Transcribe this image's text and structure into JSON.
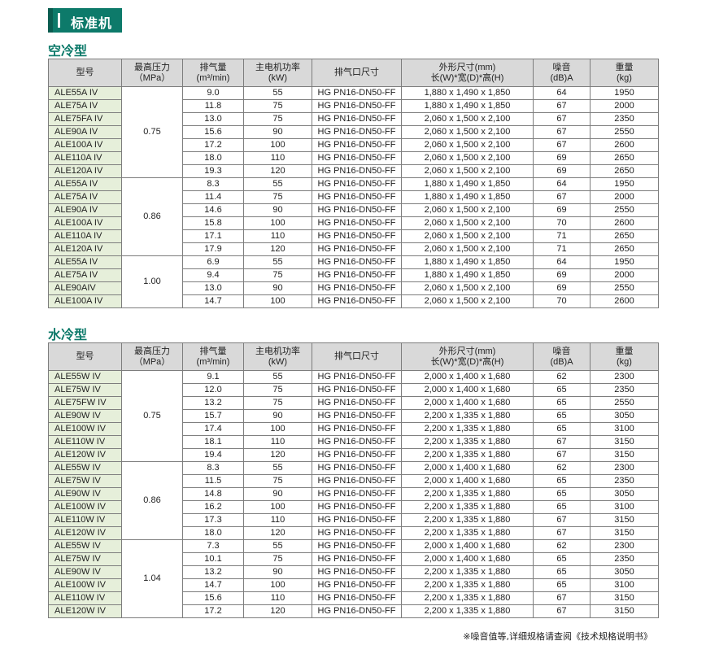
{
  "banner": {
    "title": "标准机"
  },
  "headers": {
    "model": "型号",
    "pressure": [
      "最高压力",
      "（MPa）"
    ],
    "flow": [
      "排气量",
      "(m³/min)"
    ],
    "power": [
      "主电机功率",
      "(kW)"
    ],
    "outlet": "排气口尺寸",
    "dims": [
      "外形尺寸(mm)",
      "长(W)*宽(D)*高(H)"
    ],
    "noise": [
      "噪音",
      "(dB)A"
    ],
    "weight": [
      "重量",
      "(kg)"
    ]
  },
  "sections": [
    {
      "title": "空冷型",
      "groups": [
        {
          "pressure": "0.75",
          "rows": [
            [
              "ALE55A IV",
              "9.0",
              "55",
              "HG PN16-DN50-FF",
              "1,880 x 1,490 x 1,850",
              "64",
              "1950"
            ],
            [
              "ALE75A IV",
              "11.8",
              "75",
              "HG PN16-DN50-FF",
              "1,880 x 1,490 x 1,850",
              "67",
              "2000"
            ],
            [
              "ALE75FA IV",
              "13.0",
              "75",
              "HG PN16-DN50-FF",
              "2,060 x 1,500 x 2,100",
              "67",
              "2350"
            ],
            [
              "ALE90A IV",
              "15.6",
              "90",
              "HG PN16-DN50-FF",
              "2,060 x 1,500 x 2,100",
              "67",
              "2550"
            ],
            [
              "ALE100A IV",
              "17.2",
              "100",
              "HG PN16-DN50-FF",
              "2,060 x 1,500 x 2,100",
              "67",
              "2600"
            ],
            [
              "ALE110A IV",
              "18.0",
              "110",
              "HG PN16-DN50-FF",
              "2,060 x 1,500 x 2,100",
              "69",
              "2650"
            ],
            [
              "ALE120A IV",
              "19.3",
              "120",
              "HG PN16-DN50-FF",
              "2,060 x 1,500 x 2,100",
              "69",
              "2650"
            ]
          ]
        },
        {
          "pressure": "0.86",
          "rows": [
            [
              "ALE55A IV",
              "8.3",
              "55",
              "HG PN16-DN50-FF",
              "1,880 x 1,490 x 1,850",
              "64",
              "1950"
            ],
            [
              "ALE75A IV",
              "11.4",
              "75",
              "HG PN16-DN50-FF",
              "1,880 x 1,490 x 1,850",
              "67",
              "2000"
            ],
            [
              "ALE90A IV",
              "14.6",
              "90",
              "HG PN16-DN50-FF",
              "2,060 x 1,500 x 2,100",
              "69",
              "2550"
            ],
            [
              "ALE100A IV",
              "15.8",
              "100",
              "HG PN16-DN50-FF",
              "2,060 x 1,500 x 2,100",
              "70",
              "2600"
            ],
            [
              "ALE110A IV",
              "17.1",
              "110",
              "HG PN16-DN50-FF",
              "2,060 x 1,500 x 2,100",
              "71",
              "2650"
            ],
            [
              "ALE120A IV",
              "17.9",
              "120",
              "HG PN16-DN50-FF",
              "2,060 x 1,500 x 2,100",
              "71",
              "2650"
            ]
          ]
        },
        {
          "pressure": "1.00",
          "rows": [
            [
              "ALE55A IV",
              "6.9",
              "55",
              "HG PN16-DN50-FF",
              "1,880 x 1,490 x 1,850",
              "64",
              "1950"
            ],
            [
              "ALE75A IV",
              "9.4",
              "75",
              "HG PN16-DN50-FF",
              "1,880 x 1,490 x 1,850",
              "69",
              "2000"
            ],
            [
              "ALE90AIV",
              "13.0",
              "90",
              "HG PN16-DN50-FF",
              "2,060 x 1,500 x 2,100",
              "69",
              "2550"
            ],
            [
              "ALE100A IV",
              "14.7",
              "100",
              "HG PN16-DN50-FF",
              "2,060 x 1,500 x 2,100",
              "70",
              "2600"
            ]
          ]
        }
      ]
    },
    {
      "title": "水冷型",
      "groups": [
        {
          "pressure": "0.75",
          "rows": [
            [
              "ALE55W IV",
              "9.1",
              "55",
              "HG PN16-DN50-FF",
              "2,000 x 1,400 x 1,680",
              "62",
              "2300"
            ],
            [
              "ALE75W IV",
              "12.0",
              "75",
              "HG PN16-DN50-FF",
              "2,000 x 1,400 x 1,680",
              "65",
              "2350"
            ],
            [
              "ALE75FW IV",
              "13.2",
              "75",
              "HG PN16-DN50-FF",
              "2,000 x 1,400 x 1,680",
              "65",
              "2550"
            ],
            [
              "ALE90W IV",
              "15.7",
              "90",
              "HG PN16-DN50-FF",
              "2,200 x 1,335 x 1,880",
              "65",
              "3050"
            ],
            [
              "ALE100W IV",
              "17.4",
              "100",
              "HG PN16-DN50-FF",
              "2,200 x 1,335 x 1,880",
              "65",
              "3100"
            ],
            [
              "ALE110W IV",
              "18.1",
              "110",
              "HG PN16-DN50-FF",
              "2,200 x 1,335 x 1,880",
              "67",
              "3150"
            ],
            [
              "ALE120W IV",
              "19.4",
              "120",
              "HG PN16-DN50-FF",
              "2,200 x 1,335 x 1,880",
              "67",
              "3150"
            ]
          ]
        },
        {
          "pressure": "0.86",
          "rows": [
            [
              "ALE55W IV",
              "8.3",
              "55",
              "HG PN16-DN50-FF",
              "2,000 x 1,400 x 1,680",
              "62",
              "2300"
            ],
            [
              "ALE75W IV",
              "11.5",
              "75",
              "HG PN16-DN50-FF",
              "2,000 x 1,400 x 1,680",
              "65",
              "2350"
            ],
            [
              "ALE90W IV",
              "14.8",
              "90",
              "HG PN16-DN50-FF",
              "2,200 x 1,335 x 1,880",
              "65",
              "3050"
            ],
            [
              "ALE100W IV",
              "16.2",
              "100",
              "HG PN16-DN50-FF",
              "2,200 x 1,335 x 1,880",
              "65",
              "3100"
            ],
            [
              "ALE110W IV",
              "17.3",
              "110",
              "HG PN16-DN50-FF",
              "2,200 x 1,335 x 1,880",
              "67",
              "3150"
            ],
            [
              "ALE120W IV",
              "18.0",
              "120",
              "HG PN16-DN50-FF",
              "2,200 x 1,335 x 1,880",
              "67",
              "3150"
            ]
          ]
        },
        {
          "pressure": "1.04",
          "rows": [
            [
              "ALE55W IV",
              "7.3",
              "55",
              "HG PN16-DN50-FF",
              "2,000 x 1,400 x 1,680",
              "62",
              "2300"
            ],
            [
              "ALE75W IV",
              "10.1",
              "75",
              "HG PN16-DN50-FF",
              "2,000 x 1,400 x 1,680",
              "65",
              "2350"
            ],
            [
              "ALE90W IV",
              "13.2",
              "90",
              "HG PN16-DN50-FF",
              "2,200 x 1,335 x 1,880",
              "65",
              "3050"
            ],
            [
              "ALE100W IV",
              "14.7",
              "100",
              "HG PN16-DN50-FF",
              "2,200 x 1,335 x 1,880",
              "65",
              "3100"
            ],
            [
              "ALE110W IV",
              "15.6",
              "110",
              "HG PN16-DN50-FF",
              "2,200 x 1,335 x 1,880",
              "67",
              "3150"
            ],
            [
              "ALE120W IV",
              "17.2",
              "120",
              "HG PN16-DN50-FF",
              "2,200 x 1,335 x 1,880",
              "67",
              "3150"
            ]
          ]
        }
      ]
    }
  ],
  "note": "※噪音值等,详细规格请查阅《技术规格说明书》",
  "colors": {
    "accent": "#0d7a6a",
    "model_cell": "#e6efda",
    "header_cell": "#d9d9d9"
  }
}
